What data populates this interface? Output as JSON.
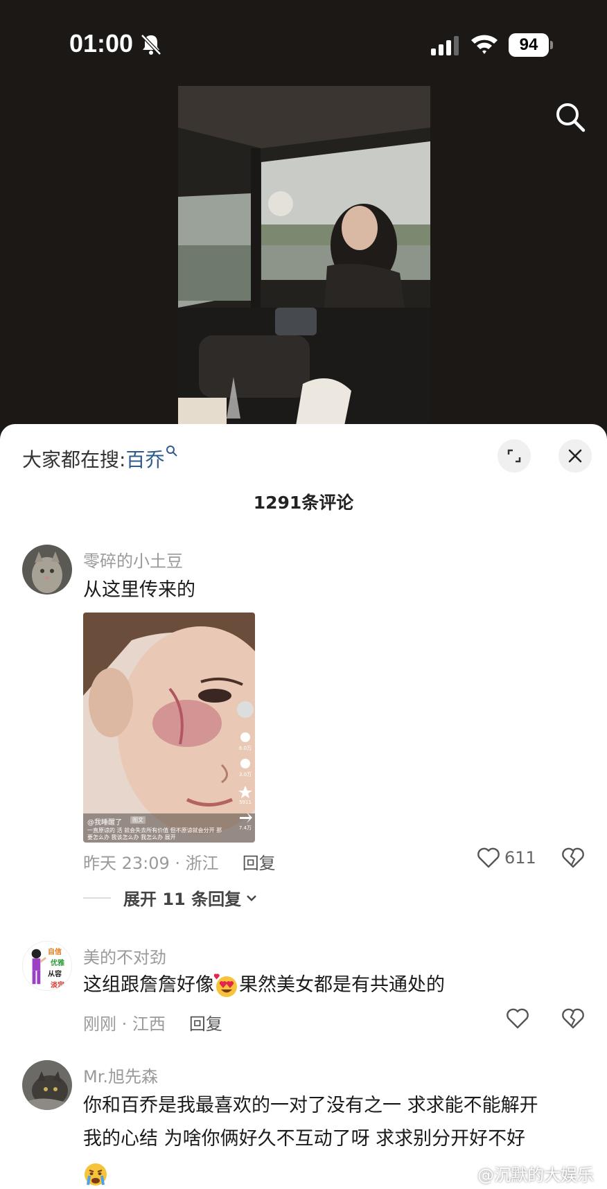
{
  "status_bar": {
    "time": "01:00",
    "battery": "94"
  },
  "hot_search": {
    "label": "大家都在搜:",
    "keyword": "百乔"
  },
  "comment_count": "1291条评论",
  "comments": [
    {
      "username": "零碎的小土豆",
      "text": "从这里传来的",
      "embedded": {
        "handle": "@我睡醒了",
        "tag": "图文",
        "caption": "一直原谅的 活 就会失去所有价值 但不原谅就会分开 那要怎么办 我该怎么办 我怎么办 展开",
        "side_counts": [
          "6.0万",
          "3.0万",
          "5911",
          "7.4万"
        ]
      },
      "time_location": "昨天 23:09 · 浙江",
      "reply_label": "回复",
      "likes": "611",
      "expand_replies": "展开 11 条回复"
    },
    {
      "username": "美的不对劲",
      "text_before": "这组跟詹詹好像",
      "text_after": "果然美女都是有共通处的",
      "emoji": "heart-eyes",
      "avatar_text": [
        "自信",
        "优雅",
        "从容",
        "淡定"
      ],
      "time_location": "刚刚 · 江西",
      "reply_label": "回复"
    },
    {
      "username": "Mr.旭先森",
      "text_line1": "你和百乔是我最喜欢的一对了没有之一 求求能不能解开",
      "text_line2": "我的心结 为啥你俩好久不互动了呀 求求别分开好不好",
      "emoji": "crying-face"
    }
  ],
  "watermark": "@沉默的大娱乐家",
  "icons": [
    "bell-muted-icon",
    "signal-icon",
    "wifi-icon",
    "battery-icon",
    "search-icon",
    "expand-icon",
    "close-icon",
    "heart-icon",
    "dislike-heart-icon",
    "chevron-down-icon",
    "weibo-logo-icon"
  ]
}
